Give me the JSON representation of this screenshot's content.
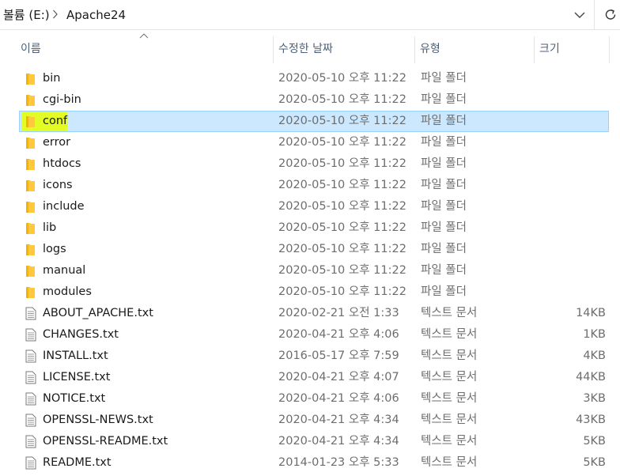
{
  "address_bar": {
    "crumbs": [
      "볼륨 (E:)",
      "Apache24"
    ]
  },
  "columns": {
    "name": "이름",
    "date": "수정한 날짜",
    "type": "유형",
    "size": "크기"
  },
  "files": [
    {
      "name": "bin",
      "date": "2020-05-10 오후 11:22",
      "type": "파일 폴더",
      "size": "",
      "kind": "folder"
    },
    {
      "name": "cgi-bin",
      "date": "2020-05-10 오후 11:22",
      "type": "파일 폴더",
      "size": "",
      "kind": "folder"
    },
    {
      "name": "conf",
      "date": "2020-05-10 오후 11:22",
      "type": "파일 폴더",
      "size": "",
      "kind": "folder",
      "selected": true
    },
    {
      "name": "error",
      "date": "2020-05-10 오후 11:22",
      "type": "파일 폴더",
      "size": "",
      "kind": "folder"
    },
    {
      "name": "htdocs",
      "date": "2020-05-10 오후 11:22",
      "type": "파일 폴더",
      "size": "",
      "kind": "folder"
    },
    {
      "name": "icons",
      "date": "2020-05-10 오후 11:22",
      "type": "파일 폴더",
      "size": "",
      "kind": "folder"
    },
    {
      "name": "include",
      "date": "2020-05-10 오후 11:22",
      "type": "파일 폴더",
      "size": "",
      "kind": "folder"
    },
    {
      "name": "lib",
      "date": "2020-05-10 오후 11:22",
      "type": "파일 폴더",
      "size": "",
      "kind": "folder"
    },
    {
      "name": "logs",
      "date": "2020-05-10 오후 11:22",
      "type": "파일 폴더",
      "size": "",
      "kind": "folder"
    },
    {
      "name": "manual",
      "date": "2020-05-10 오후 11:22",
      "type": "파일 폴더",
      "size": "",
      "kind": "folder"
    },
    {
      "name": "modules",
      "date": "2020-05-10 오후 11:22",
      "type": "파일 폴더",
      "size": "",
      "kind": "folder"
    },
    {
      "name": "ABOUT_APACHE.txt",
      "date": "2020-02-21 오전 1:33",
      "type": "텍스트 문서",
      "size": "14KB",
      "kind": "text"
    },
    {
      "name": "CHANGES.txt",
      "date": "2020-04-21 오후 4:06",
      "type": "텍스트 문서",
      "size": "1KB",
      "kind": "text"
    },
    {
      "name": "INSTALL.txt",
      "date": "2016-05-17 오후 7:59",
      "type": "텍스트 문서",
      "size": "4KB",
      "kind": "text"
    },
    {
      "name": "LICENSE.txt",
      "date": "2020-04-21 오후 4:07",
      "type": "텍스트 문서",
      "size": "44KB",
      "kind": "text"
    },
    {
      "name": "NOTICE.txt",
      "date": "2020-04-21 오후 4:06",
      "type": "텍스트 문서",
      "size": "3KB",
      "kind": "text"
    },
    {
      "name": "OPENSSL-NEWS.txt",
      "date": "2020-04-21 오후 4:34",
      "type": "텍스트 문서",
      "size": "43KB",
      "kind": "text"
    },
    {
      "name": "OPENSSL-README.txt",
      "date": "2020-04-21 오후 4:34",
      "type": "텍스트 문서",
      "size": "5KB",
      "kind": "text"
    },
    {
      "name": "README.txt",
      "date": "2014-01-23 오후 5:33",
      "type": "텍스트 문서",
      "size": "5KB",
      "kind": "text"
    }
  ],
  "icons": {
    "folder": "folder-icon",
    "text": "text-document-icon",
    "sort": "sort-ascending-icon",
    "separator": "chevron-right-icon",
    "dropdown": "chevron-down-icon",
    "refresh": "refresh-icon"
  },
  "colors": {
    "selection_background": "#cce8ff",
    "selection_border": "#99d1ff",
    "highlight_marker": "#e6ff00",
    "folder_yellow": "#ffc83d"
  }
}
